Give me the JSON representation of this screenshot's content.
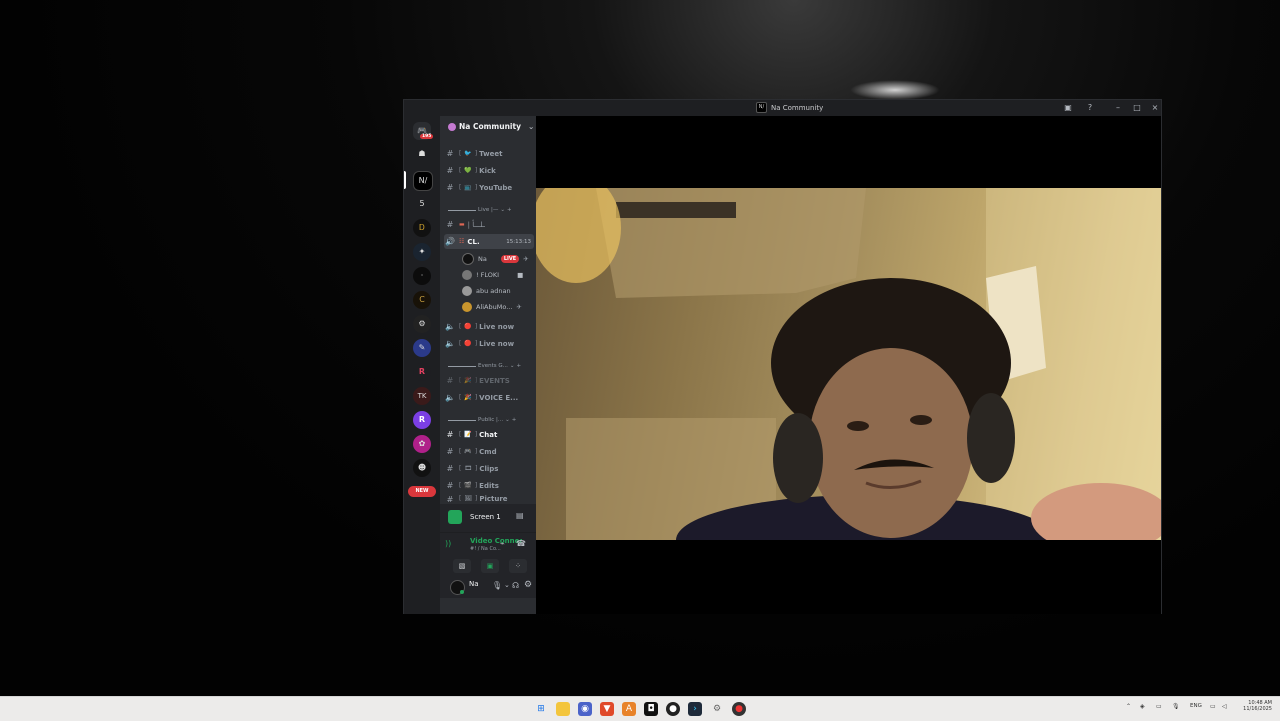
{
  "window": {
    "title": "Na Community",
    "controls": [
      "inbox-icon",
      "help-icon",
      "minimize-icon",
      "maximize-icon",
      "close-icon"
    ]
  },
  "rail": {
    "items": [
      {
        "icon": "discord-logo-icon",
        "badge": "195"
      },
      {
        "icon": "robot-icon",
        "label": ""
      },
      {
        "icon": "na-server-icon",
        "label": "N/"
      },
      {
        "icon": "number-server-icon",
        "label": "5"
      },
      {
        "icon": "swirl-server-icon",
        "label": "Ꭰ"
      },
      {
        "icon": "figure-server-icon",
        "label": ""
      },
      {
        "icon": "dark-server-icon",
        "label": ""
      },
      {
        "icon": "c-server-icon",
        "label": "C"
      },
      {
        "icon": "gear-server-icon",
        "label": ""
      },
      {
        "icon": "feather-server-icon",
        "label": ""
      },
      {
        "icon": "r-server-icon",
        "label": "R"
      },
      {
        "icon": "tk-server-icon",
        "label": "TK"
      },
      {
        "icon": "purple-r-server-icon",
        "label": "R"
      },
      {
        "icon": "pink-server-icon",
        "label": ""
      },
      {
        "icon": "face-server-icon",
        "label": ""
      }
    ],
    "new_badge": "NEW"
  },
  "sidebar": {
    "server_name": "Na Community",
    "channels_top": [
      {
        "emoji": "🐦",
        "name": "Tweet"
      },
      {
        "emoji": "💚",
        "name": "Kick"
      },
      {
        "emoji": "📺",
        "name": "YouTube"
      }
    ],
    "cat_live": "Live |—",
    "live_text_channel": "| ـلـــأ",
    "active_voice": {
      "name": "CL.",
      "timer": "15:13:13"
    },
    "voice_users": [
      {
        "name": "Na",
        "live": "LIVE"
      },
      {
        "name": "! FLOKI"
      },
      {
        "name": "abu adnan"
      },
      {
        "name": "AliAbuMo..."
      }
    ],
    "live_channels": [
      {
        "emoji": "🔴",
        "name": "Live now"
      },
      {
        "emoji": "🔴",
        "name": "Live now"
      }
    ],
    "cat_events": "Events G...",
    "events_channels": [
      {
        "emoji": "🎉",
        "name": "EVENTS"
      },
      {
        "emoji": "🎉",
        "name": "VOICE E..."
      }
    ],
    "cat_public": "Public |...",
    "public_channels": [
      {
        "emoji": "📝",
        "name": "Chat"
      },
      {
        "emoji": "🎮",
        "name": "Cmd"
      },
      {
        "emoji": "🎞",
        "name": "Clips"
      },
      {
        "emoji": "🎬",
        "name": "Edits"
      },
      {
        "emoji": "🖼",
        "name": "Picture"
      }
    ]
  },
  "stream_panel": {
    "label": "Screen 1"
  },
  "voice_panel": {
    "status": "Video Connected",
    "sub": "#! / Na Co..."
  },
  "user_panel": {
    "name": "Na"
  },
  "taskbar": {
    "lang": "ENG",
    "time": "10:48 AM",
    "date": "11/16/2025"
  }
}
